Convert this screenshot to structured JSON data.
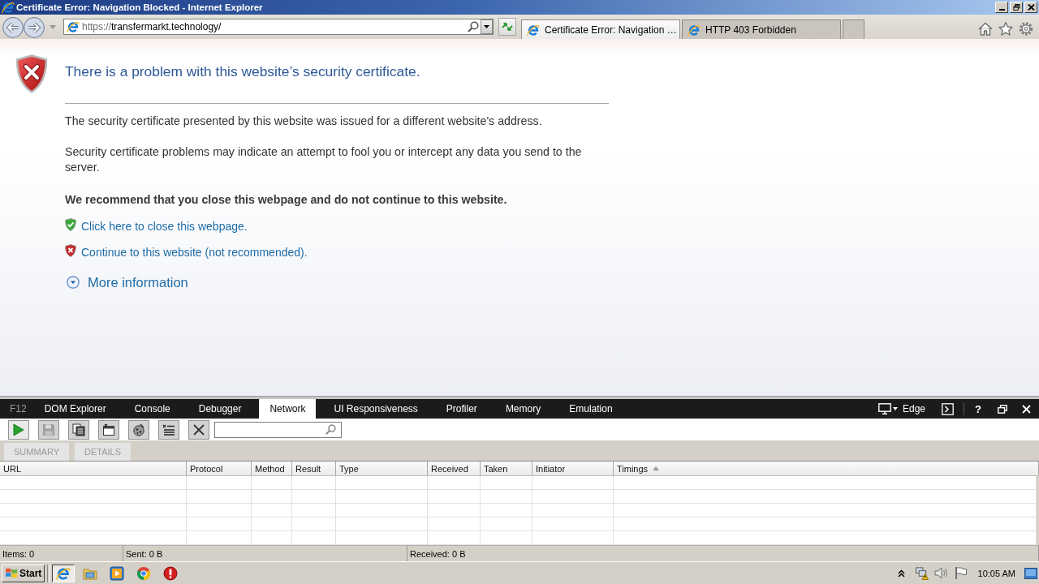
{
  "window": {
    "title": "Certificate Error: Navigation Blocked - Internet Explorer"
  },
  "address": {
    "scheme": "https://",
    "rest": "transfermarkt.technology/"
  },
  "tabs": [
    {
      "label": "Certificate Error: Navigation …",
      "selected": true
    },
    {
      "label": "HTTP 403 Forbidden",
      "selected": false
    }
  ],
  "page": {
    "heading": "There is a problem with this website’s security certificate.",
    "paragraphs": [
      "The security certificate presented by this website was issued for a different website's address.",
      "Security certificate problems may indicate an attempt to fool you or intercept any data you send to the server."
    ],
    "recommendation": "We recommend that you close this webpage and do not continue to this website.",
    "links": [
      {
        "kind": "safe",
        "text": "Click here to close this webpage."
      },
      {
        "kind": "unsafe",
        "text": "Continue to this website (not recommended)."
      }
    ],
    "more_info": {
      "label": "More information",
      "expanded": false
    }
  },
  "devtools": {
    "f12": "F12",
    "tabs": [
      {
        "label": "DOM Explorer",
        "selected": false
      },
      {
        "label": "Console",
        "selected": false
      },
      {
        "label": "Debugger",
        "selected": false
      },
      {
        "label": "Network",
        "selected": true
      },
      {
        "label": "UI Responsiveness",
        "selected": false
      },
      {
        "label": "Profiler",
        "selected": false
      },
      {
        "label": "Memory",
        "selected": false
      },
      {
        "label": "Emulation",
        "selected": false
      }
    ],
    "mode": "Edge",
    "help": "?",
    "toolbar": [
      {
        "kind": "play",
        "disabled": false
      },
      {
        "kind": "save",
        "disabled": true
      },
      {
        "kind": "pages",
        "disabled": false
      },
      {
        "kind": "window",
        "disabled": false
      },
      {
        "kind": "cookie",
        "disabled": false
      },
      {
        "kind": "list",
        "disabled": false
      },
      {
        "kind": "cross",
        "disabled": false
      }
    ],
    "views": [
      {
        "label": "SUMMARY",
        "disabled": true
      },
      {
        "label": "DETAILS",
        "disabled": true
      }
    ],
    "columns": [
      {
        "label": "URL",
        "sorted": false
      },
      {
        "label": "Protocol",
        "sorted": false
      },
      {
        "label": "Method",
        "sorted": false
      },
      {
        "label": "Result",
        "sorted": false
      },
      {
        "label": "Type",
        "sorted": false
      },
      {
        "label": "Received",
        "sorted": false
      },
      {
        "label": "Taken",
        "sorted": false
      },
      {
        "label": "Initiator",
        "sorted": false
      },
      {
        "label": "Timings",
        "sorted": true
      }
    ],
    "status": [
      "Items: 0",
      "Sent: 0 B",
      "Received: 0 B"
    ]
  },
  "taskbar": {
    "start": "Start",
    "apps": [
      {
        "kind": "browser",
        "selected": true
      },
      {
        "kind": "folder",
        "selected": false
      },
      {
        "kind": "player",
        "selected": false
      },
      {
        "kind": "orb",
        "selected": false
      },
      {
        "kind": "stop",
        "selected": false
      }
    ],
    "clock": "10:05 AM"
  }
}
